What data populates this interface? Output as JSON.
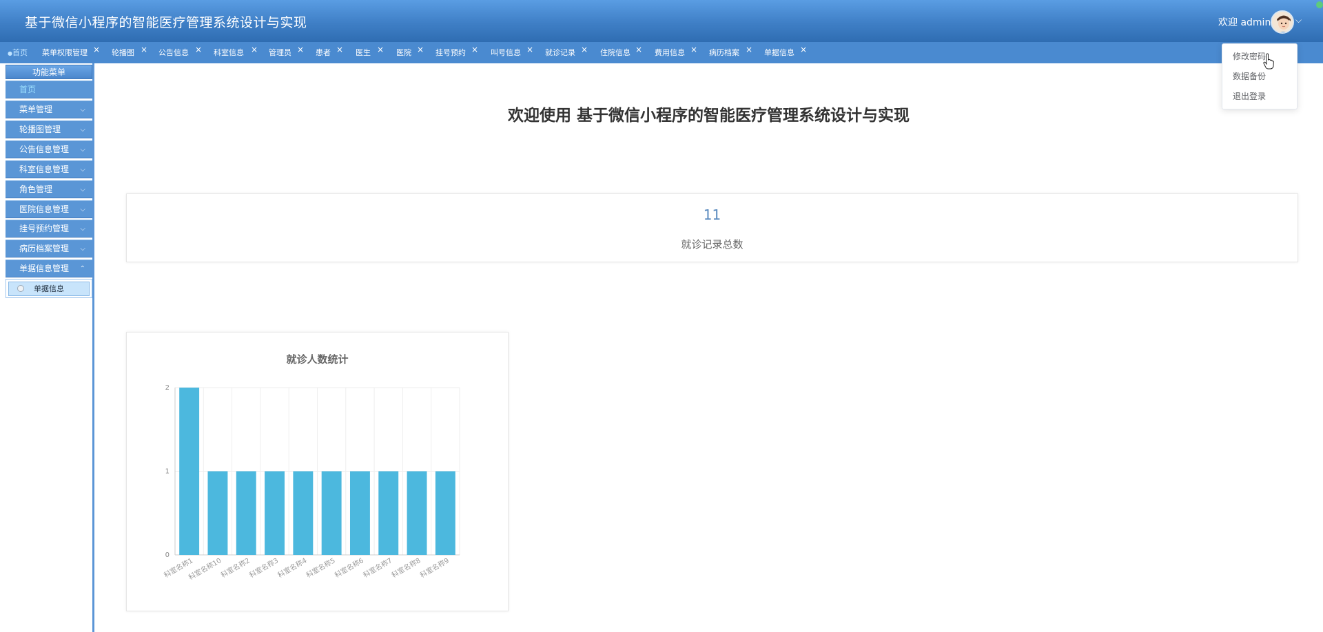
{
  "header": {
    "title": "基于微信小程序的智能医疗管理系统设计与实现",
    "welcome": "欢迎 admin",
    "chevron": "⌵",
    "avatar_icon": "user-avatar-icon",
    "status_dot_color": "#5ecb7c"
  },
  "tabs": [
    {
      "label": "首页",
      "active": true,
      "closable": false
    },
    {
      "label": "菜单权限管理",
      "closable": true
    },
    {
      "label": "轮播图",
      "closable": true
    },
    {
      "label": "公告信息",
      "closable": true
    },
    {
      "label": "科室信息",
      "closable": true
    },
    {
      "label": "管理员",
      "closable": true
    },
    {
      "label": "患者",
      "closable": true
    },
    {
      "label": "医生",
      "closable": true
    },
    {
      "label": "医院",
      "closable": true
    },
    {
      "label": "挂号预约",
      "closable": true
    },
    {
      "label": "叫号信息",
      "closable": true
    },
    {
      "label": "就诊记录",
      "closable": true
    },
    {
      "label": "住院信息",
      "closable": true
    },
    {
      "label": "费用信息",
      "closable": true
    },
    {
      "label": "病历档案",
      "closable": true
    },
    {
      "label": "单据信息",
      "closable": false
    }
  ],
  "tab_close_glyph": "×",
  "tab_active_dot": "●",
  "dropdown": {
    "items": [
      "修改密码",
      "数据备份",
      "退出登录"
    ]
  },
  "sidebar": {
    "title": "功能菜单",
    "items": [
      {
        "label": "首页",
        "chevron": ""
      },
      {
        "label": "菜单管理",
        "chevron": "⌵"
      },
      {
        "label": "轮播图管理",
        "chevron": "⌵"
      },
      {
        "label": "公告信息管理",
        "chevron": "⌵"
      },
      {
        "label": "科室信息管理",
        "chevron": "⌵"
      },
      {
        "label": "角色管理",
        "chevron": "⌵"
      },
      {
        "label": "医院信息管理",
        "chevron": "⌵"
      },
      {
        "label": "挂号预约管理",
        "chevron": "⌵"
      },
      {
        "label": "病历档案管理",
        "chevron": "⌵"
      },
      {
        "label": "单据信息管理",
        "chevron": "⌃"
      }
    ],
    "submenu_label": "单据信息"
  },
  "main": {
    "welcome": "欢迎使用 基于微信小程序的智能医疗管理系统设计与实现",
    "stat": {
      "value": "11",
      "label": "就诊记录总数"
    }
  },
  "colors": {
    "bar": "#4cb8de",
    "accent": "#4a8ad0"
  },
  "chart_data": {
    "type": "bar",
    "title": "就诊人数统计",
    "categories": [
      "科室名称1",
      "科室名称10",
      "科室名称2",
      "科室名称3",
      "科室名称4",
      "科室名称5",
      "科室名称6",
      "科室名称7",
      "科室名称8",
      "科室名称9"
    ],
    "values": [
      2,
      1,
      1,
      1,
      1,
      1,
      1,
      1,
      1,
      1
    ],
    "yticks": [
      "0",
      "1",
      "2"
    ],
    "ylim": [
      0,
      2
    ],
    "xlabel": "",
    "ylabel": "",
    "grid": true
  }
}
